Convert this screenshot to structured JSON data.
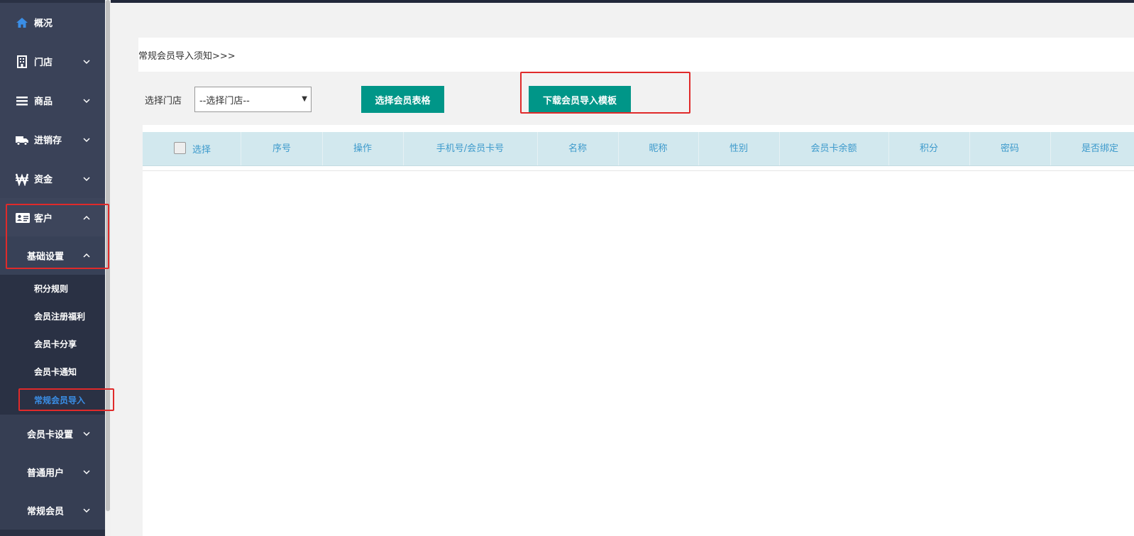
{
  "sidebar": {
    "overview": {
      "label": "概况",
      "icon": "home-icon"
    },
    "store": {
      "label": "门店",
      "icon": "building-icon"
    },
    "goods": {
      "label": "商品",
      "icon": "list-icon"
    },
    "inventory": {
      "label": "进销存",
      "icon": "truck-icon"
    },
    "funds": {
      "label": "资金",
      "icon": "won-icon"
    },
    "customer": {
      "label": "客户",
      "icon": "id-card-icon",
      "expanded": true
    },
    "basic_settings": {
      "label": "基础设置",
      "expanded": true
    },
    "leaf_items": [
      "积分规则",
      "会员注册福利",
      "会员卡分享",
      "会员卡通知",
      "常规会员导入"
    ],
    "active_leaf": "常规会员导入",
    "card_settings": {
      "label": "会员卡设置"
    },
    "normal_users": {
      "label": "普通用户"
    },
    "regular_members": {
      "label": "常规会员"
    }
  },
  "main": {
    "notice": "常规会员导入须知>>>",
    "store_label": "选择门店",
    "store_select_value": "--选择门店--",
    "select_table_button": "选择会员表格",
    "download_template_button": "下载会员导入模板",
    "table_headers": [
      "选择",
      "序号",
      "操作",
      "手机号/会员卡号",
      "名称",
      "昵称",
      "性别",
      "会员卡余额",
      "积分",
      "密码",
      "是否绑定"
    ],
    "rows": []
  },
  "colors": {
    "sidebar_bg": "#2a3144",
    "sidebar_item_bg": "#3a4258",
    "active_link": "#3a8ee6",
    "primary_button": "#009688",
    "table_header_bg": "#d2e8ee",
    "table_header_text": "#3d9acc",
    "highlight_box": "#e02a2a"
  }
}
